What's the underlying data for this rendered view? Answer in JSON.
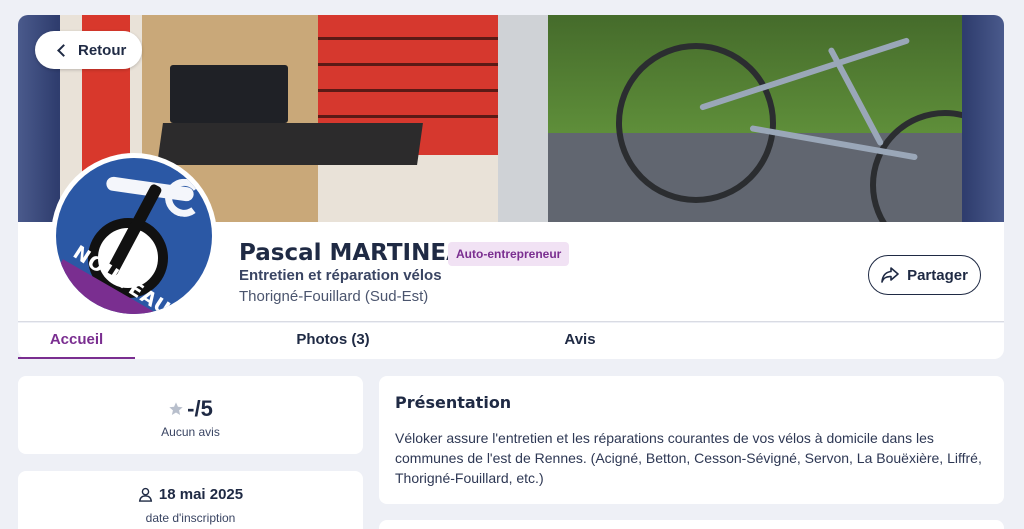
{
  "header": {
    "back_label": "Retour",
    "share_label": "Partager"
  },
  "avatar": {
    "ribbon_text": "NOUVEAU"
  },
  "profile": {
    "name": "Pascal MARTINEAU",
    "badge": "Auto-entrepreneur",
    "job": "Entretien et réparation vélos",
    "location": "Thorigné-Fouillard (Sud-Est)"
  },
  "tabs": [
    {
      "label": "Accueil",
      "active": true
    },
    {
      "label": "Photos (3)",
      "active": false
    },
    {
      "label": "Avis",
      "active": false
    }
  ],
  "rating": {
    "value": "-/5",
    "subtitle": "Aucun avis"
  },
  "registration": {
    "date": "18 mai 2025",
    "subtitle": "date d'inscription"
  },
  "presentation": {
    "title": "Présentation",
    "text": "Véloker assure l'entretien et les réparations courantes de vos vélos à domicile dans les communes de l'est de Rennes. (Acigné, Betton, Cesson-Sévigné, Servon, La Bouëxière, Liffré, Thorigné-Fouillard, etc.)"
  },
  "colors": {
    "accent": "#7a2e90",
    "text": "#1f2a44",
    "background": "#eef0f6"
  },
  "icons": {
    "back": "chevron-left-icon",
    "share": "share-icon",
    "rating": "star-icon",
    "registration": "user-icon"
  }
}
